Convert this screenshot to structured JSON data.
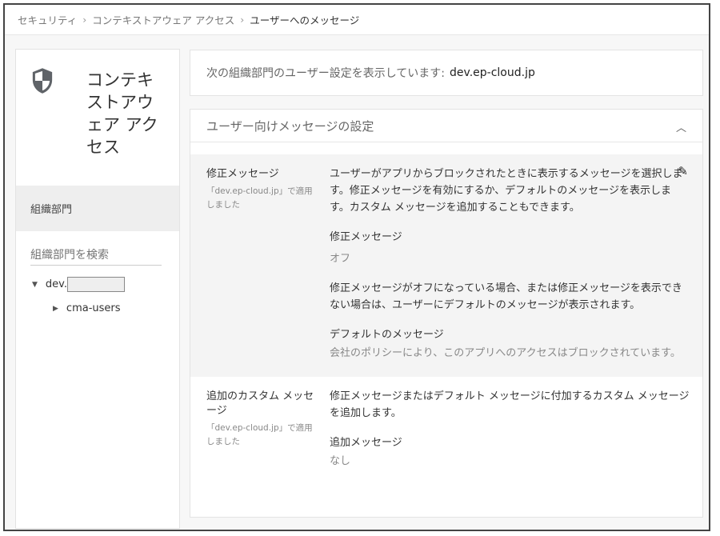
{
  "breadcrumb": {
    "items": [
      "セキュリティ",
      "コンテキストアウェア アクセス"
    ],
    "current": "ユーザーへのメッセージ",
    "separator": "›"
  },
  "sidebar": {
    "title": "コンテキストアウェア アクセス",
    "org_units_label": "組織部門",
    "search_placeholder": "組織部門を検索",
    "tree": [
      {
        "label": "dev.",
        "expanded": true
      },
      {
        "label": "cma-users",
        "expanded": false
      }
    ]
  },
  "info": {
    "text": "次の組織部門のユーザー設定を表示しています:",
    "org": "dev.ep-cloud.jp"
  },
  "card": {
    "title": "ユーザー向けメッセージの設定",
    "sections": [
      {
        "label": "修正メッセージ",
        "applied": "「dev.ep-cloud.jp」で適用しました",
        "description": "ユーザーがアプリからブロックされたときに表示するメッセージを選択します。修正メッセージを有効にするか、デフォルトのメッセージを表示します。カスタム メッセージを追加することもできます。",
        "field1_label": "修正メッセージ",
        "field1_value": "オフ",
        "note": "修正メッセージがオフになっている場合、または修正メッセージを表示できない場合は、ユーザーにデフォルトのメッセージが表示されます。",
        "field2_label": "デフォルトのメッセージ",
        "field2_value": "会社のポリシーにより、このアプリへのアクセスはブロックされています。"
      },
      {
        "label": "追加のカスタム メッセージ",
        "applied": "「dev.ep-cloud.jp」で適用しました",
        "description": "修正メッセージまたはデフォルト メッセージに付加するカスタム メッセージを追加します。",
        "field1_label": "追加メッセージ",
        "field1_value": "なし"
      }
    ]
  }
}
